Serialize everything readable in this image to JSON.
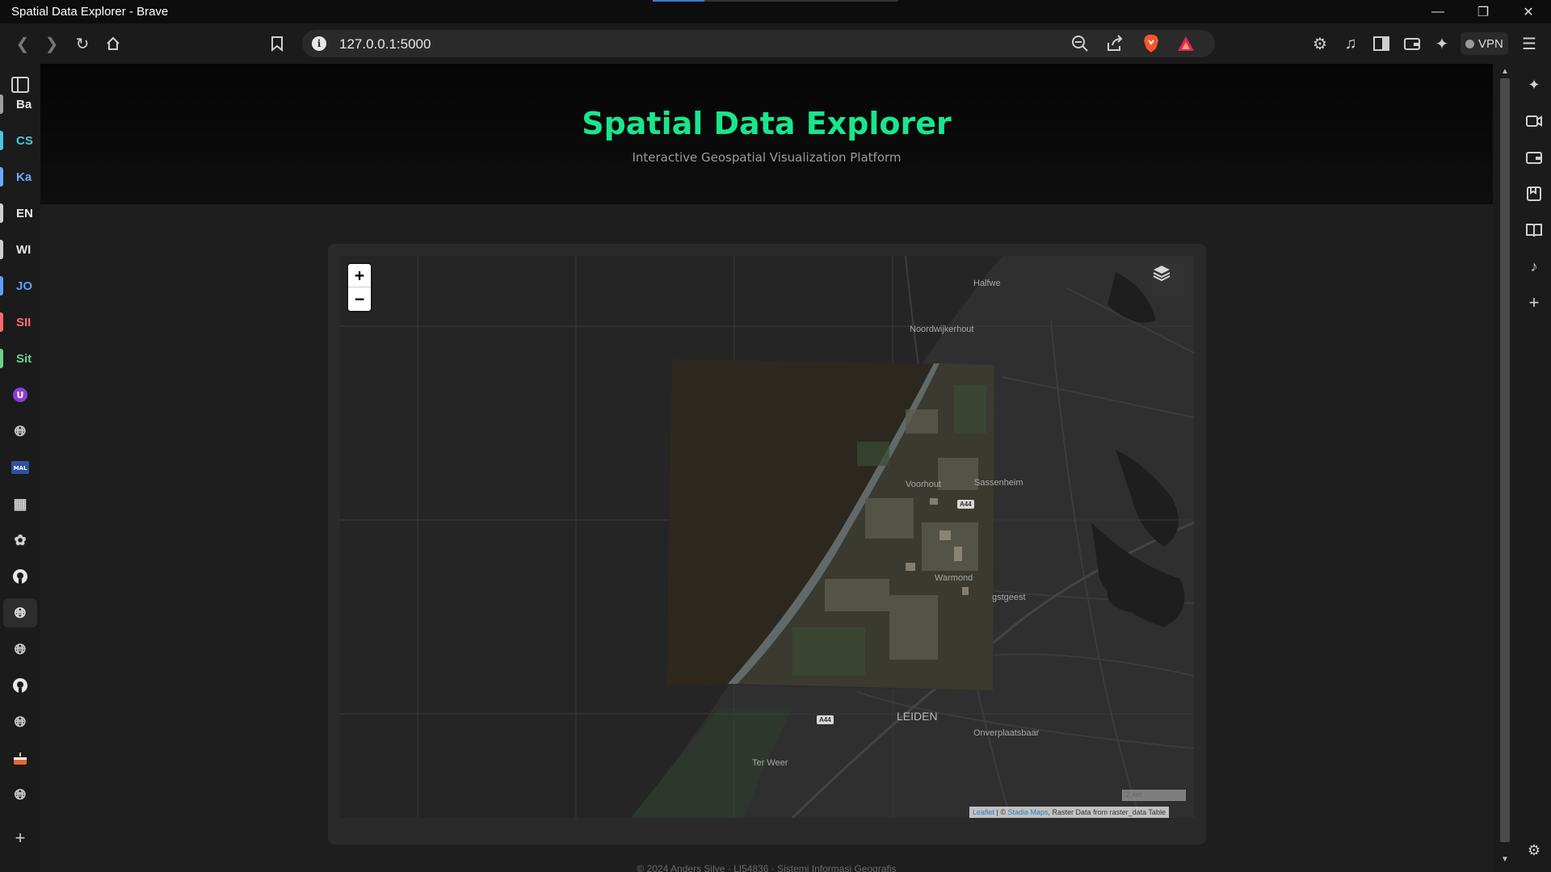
{
  "window": {
    "title": "Spatial Data Explorer - Brave"
  },
  "browser": {
    "url": "127.0.0.1:5000",
    "vpn_label": "VPN"
  },
  "sidebar": {
    "items": [
      {
        "label": "Ba",
        "color": "#e8e8e8",
        "bar": "#9e9e9e"
      },
      {
        "label": "CS",
        "color": "#4dc4e0",
        "bar": "#4dc4e0"
      },
      {
        "label": "Ka",
        "color": "#6fa8ff",
        "bar": "#6fa8ff"
      },
      {
        "label": "EN",
        "color": "#e8e8e8",
        "bar": "#cfcfcf"
      },
      {
        "label": "WI",
        "color": "#e8e8e8",
        "bar": "#cfcfcf"
      },
      {
        "label": "JO",
        "color": "#5aa0ff",
        "bar": "#5aa0ff"
      },
      {
        "label": "SII",
        "color": "#ff6b6b",
        "bar": "#ff6b6b"
      },
      {
        "label": "Sit",
        "color": "#6ad38a",
        "bar": "#6ad38a"
      }
    ]
  },
  "page": {
    "title": "Spatial Data Explorer",
    "subtitle": "Interactive Geospatial Visualization Platform",
    "footer": "© 2024 Anders Silve · LI54836 · Sistemi Informasi Geografis"
  },
  "map": {
    "zoom_in": "+",
    "zoom_out": "−",
    "scale_label": "2 km",
    "attribution": {
      "leaflet": "Leaflet",
      "sep1": " | © ",
      "stadia": "Stadia Maps",
      "rest": ", Raster Data from raster_data Table"
    },
    "places": {
      "halfweg": "Halfwe",
      "noordwijkerhout": "Noordwijkerhout",
      "voorhout": "Voorhout",
      "sassenheim": "Sassenheim",
      "warmond": "Warmond",
      "oegstgeest": "gstgeest",
      "leiden": "LEIDEN",
      "onverplaatsbaar": "Onverplaatsbaar",
      "ter_weer": "Ter Weer"
    },
    "roads": {
      "a44_top": "A44",
      "a44_bottom": "A44"
    }
  }
}
